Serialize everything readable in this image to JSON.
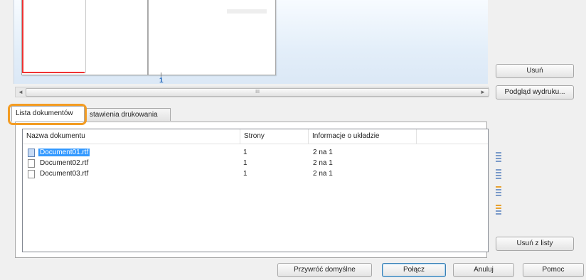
{
  "preview": {
    "page_number": "1",
    "scroll_glyph": "III",
    "scroll_left_arrow": "◄",
    "scroll_right_arrow": "►"
  },
  "buttons": {
    "delete": "Usuń",
    "print_preview": "Podgląd wydruku...",
    "remove_from_list": "Usuń z listy",
    "restore_defaults": "Przywróć domyślne",
    "combine": "Połącz",
    "cancel": "Anuluj",
    "help": "Pomoc"
  },
  "tabs": [
    {
      "label": "Lista dokumentów",
      "active": true
    },
    {
      "label": "stawienia drukowania",
      "active": false
    }
  ],
  "document_list": {
    "columns": [
      "Nazwa dokumentu",
      "Strony",
      "Informacje o układzie"
    ],
    "rows": [
      {
        "name": "Document01.rtf",
        "pages": "1",
        "layout": "2 na 1",
        "selected": true
      },
      {
        "name": "Document02.rtf",
        "pages": "1",
        "layout": "2 na 1",
        "selected": false
      },
      {
        "name": "Document03.rtf",
        "pages": "1",
        "layout": "2 na 1",
        "selected": false
      }
    ]
  },
  "colors": {
    "highlight_outline": "#f39c23",
    "selection": "#3399ff",
    "page_number": "#1d62b6"
  }
}
